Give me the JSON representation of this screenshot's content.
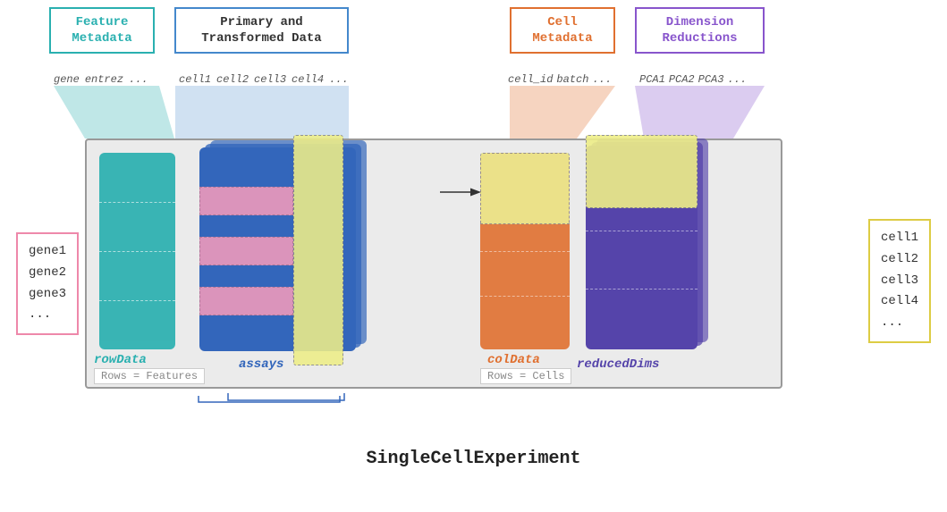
{
  "title": "SingleCellExperiment",
  "header_boxes": [
    {
      "id": "feature-meta",
      "label": "Feature\nMetadata",
      "color": "#2ab0b0"
    },
    {
      "id": "primary-data",
      "label": "Primary and\nTransformed Data",
      "color": "#4488cc"
    },
    {
      "id": "cell-meta",
      "label": "Cell\nMetadata",
      "color": "#e07030"
    },
    {
      "id": "dim-red",
      "label": "Dimension\nReductions",
      "color": "#8855cc"
    }
  ],
  "col_labels": {
    "feature_meta": [
      "gene",
      "entrez",
      "..."
    ],
    "primary_data": [
      "cell1",
      "cell2",
      "cell3",
      "cell4",
      "..."
    ],
    "cell_meta": [
      "cell_id",
      "batch",
      "..."
    ],
    "dim_red": [
      "PCA1",
      "PCA2",
      "PCA3",
      "..."
    ]
  },
  "row_labels": {
    "genes": [
      "gene1",
      "gene2",
      "gene3",
      "..."
    ],
    "cells": [
      "cell1",
      "cell2",
      "cell3",
      "cell4",
      "..."
    ]
  },
  "block_labels": {
    "rowdata": "rowData",
    "assays": "assays",
    "coldata": "colData",
    "reduced_dims": "reducedDims"
  },
  "rows_labels": {
    "features": "Rows = Features",
    "cells": "Rows = Cells"
  }
}
